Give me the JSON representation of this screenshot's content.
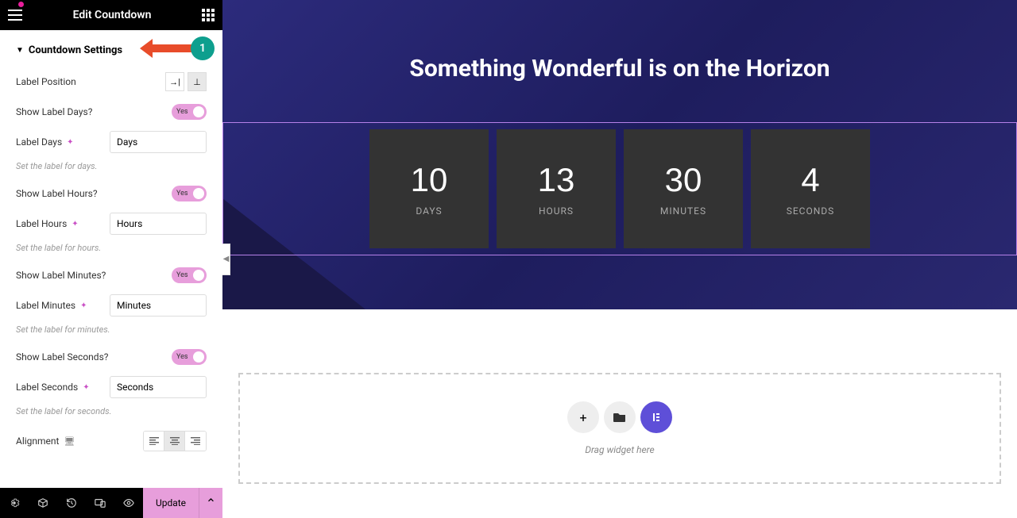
{
  "header": {
    "title": "Edit Countdown"
  },
  "section": {
    "title": "Countdown Settings",
    "callout_number": "1"
  },
  "controls": {
    "label_position": "Label Position",
    "show_days": {
      "label": "Show Label Days?",
      "value": "Yes"
    },
    "label_days": {
      "label": "Label Days",
      "value": "Days",
      "help": "Set the label for days."
    },
    "show_hours": {
      "label": "Show Label Hours?",
      "value": "Yes"
    },
    "label_hours": {
      "label": "Label Hours",
      "value": "Hours",
      "help": "Set the label for hours."
    },
    "show_minutes": {
      "label": "Show Label Minutes?",
      "value": "Yes"
    },
    "label_minutes": {
      "label": "Label Minutes",
      "value": "Minutes",
      "help": "Set the label for minutes."
    },
    "show_seconds": {
      "label": "Show Label Seconds?",
      "value": "Yes"
    },
    "label_seconds": {
      "label": "Label Seconds",
      "value": "Seconds",
      "help": "Set the label for seconds."
    },
    "alignment": "Alignment"
  },
  "footer": {
    "update": "Update"
  },
  "hero": {
    "title": "Something Wonderful is on the Horizon"
  },
  "countdown": {
    "days": {
      "num": "10",
      "label": "DAYS"
    },
    "hours": {
      "num": "13",
      "label": "HOURS"
    },
    "minutes": {
      "num": "30",
      "label": "MINUTES"
    },
    "seconds": {
      "num": "4",
      "label": "SECONDS"
    }
  },
  "dropzone": {
    "text": "Drag widget here"
  }
}
